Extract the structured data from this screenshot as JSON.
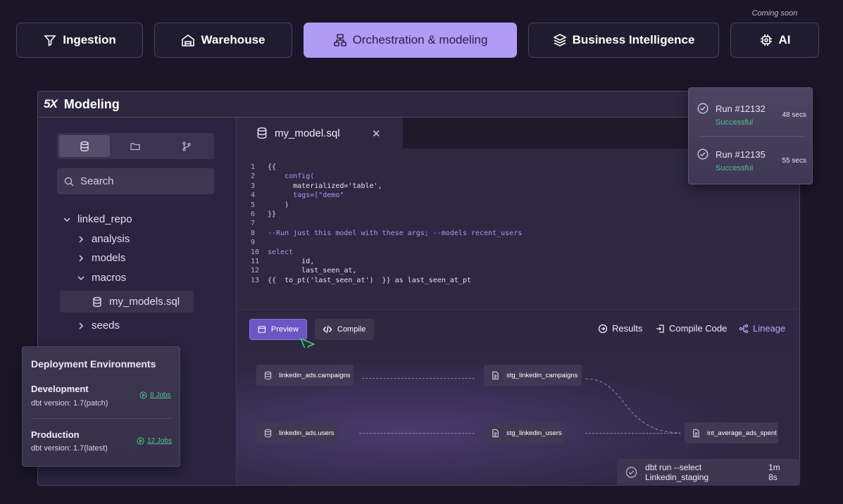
{
  "coming_soon": "Coming soon",
  "nav": {
    "ingestion": "Ingestion",
    "warehouse": "Warehouse",
    "orchestration": "Orchestration & modeling",
    "bi": "Business Intelligence",
    "ai": "AI"
  },
  "app": {
    "logo": "5X",
    "title": "Modeling"
  },
  "sidebar": {
    "search_placeholder": "Search",
    "tree": {
      "root": "linked_repo",
      "analysis": "analysis",
      "models": "models",
      "macros": "macros",
      "file": "my_models.sql",
      "seeds": "seeds"
    }
  },
  "editor": {
    "tab_name": "my_model.sql",
    "close": "✕",
    "code": {
      "l1": "{{",
      "l2": "    config(",
      "l3": "      materialized='table',",
      "l4": "      tags=[\"demo\"",
      "l5": "    )",
      "l6": "}}",
      "l7": "",
      "l8": "--Run just this model with these args; --models recent_users",
      "l9": "",
      "l10": "select",
      "l11": "        id,",
      "l12": "        last_seen_at,",
      "l13": "{{  to_pt('last_seen_at')  }} as last_seen_at_pt"
    }
  },
  "toolbar": {
    "preview": "Preview",
    "compile": "Compile",
    "results": "Results",
    "compile_code": "Compile Code",
    "lineage": "Lineage"
  },
  "lineage": {
    "n1": "linkedin_ads.campaigns",
    "n2": "stg_linkedin_campaigns",
    "n3": "linkedin_ads.users",
    "n4": "stg_linkedin_users",
    "n5": "int_average_ads_spent"
  },
  "run_status": {
    "command": "dbt run --select Linkedin_staging",
    "duration": "1m 8s"
  },
  "runs": [
    {
      "name": "Run #12132",
      "status": "Successful",
      "secs": "48 secs"
    },
    {
      "name": "Run #12135",
      "status": "Successful",
      "secs": "55 secs"
    }
  ],
  "deploy": {
    "title": "Deployment Environments",
    "envs": [
      {
        "name": "Development",
        "version": "dbt version: 1.7(patch)",
        "jobs": "8 Jobs"
      },
      {
        "name": "Production",
        "version": "dbt version: 1.7(latest)",
        "jobs": "12 Jobs"
      }
    ]
  },
  "colors": {
    "accent": "#b19bf5",
    "preview": "#6c55c4",
    "success": "#4fc28a",
    "background": "#1a1628"
  },
  "icons": {
    "ingestion": "filter-icon",
    "warehouse": "warehouse-icon",
    "orchestration": "workflow-icon",
    "bi": "layers-icon",
    "ai": "chip-icon"
  }
}
